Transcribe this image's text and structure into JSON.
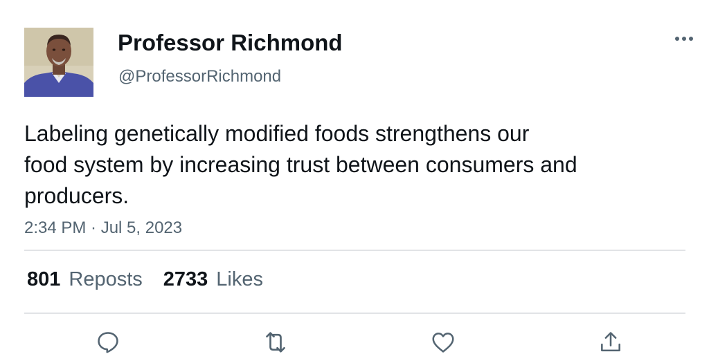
{
  "author": {
    "display_name": "Professor Richmond",
    "handle": "@ProfessorRichmond",
    "avatar_icon": "user-avatar-photo"
  },
  "tweet": {
    "text_lines": [
      "Labeling genetically modified foods strengthens our",
      "food system by increasing trust between consumers and",
      "producers."
    ],
    "timestamp": "2:34 PM · Jul 5, 2023"
  },
  "stats": {
    "reposts_count": "801",
    "reposts_label": "Reposts",
    "likes_count": "2733",
    "likes_label": "Likes"
  },
  "actions": {
    "reply_icon": "reply-bubble-icon",
    "repost_icon": "repost-arrows-icon",
    "like_icon": "heart-icon",
    "share_icon": "share-upload-icon",
    "more_icon": "more-dots-icon"
  },
  "colors": {
    "text_primary": "#0f1419",
    "text_secondary": "#536471",
    "divider": "#e1e3e6"
  }
}
